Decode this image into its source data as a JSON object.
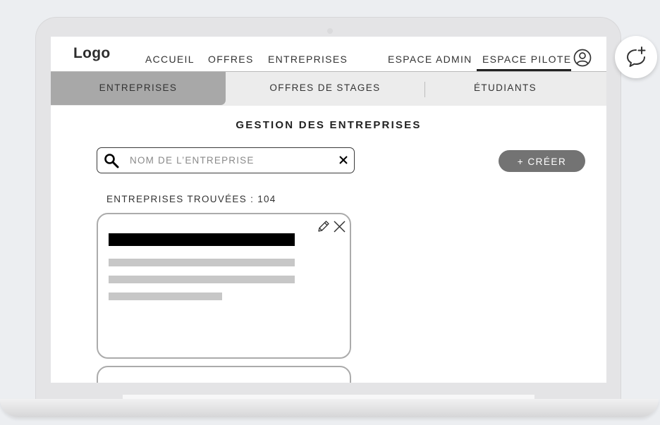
{
  "header": {
    "logo": "Logo",
    "nav": [
      "ACCUEIL",
      "OFFRES",
      "ENTREPRISES",
      "ESPACE ADMIN",
      "ESPACE PILOTE"
    ],
    "active_nav": "ESPACE PILOTE",
    "user_icon": "user-circle-icon"
  },
  "subtabs": [
    "ENTREPRISES",
    "OFFRES DE STAGES",
    "ÉTUDIANTS"
  ],
  "active_subtab": "ENTREPRISES",
  "page": {
    "title": "GESTION DES ENTREPRISES",
    "search": {
      "placeholder": "NOM DE L’ENTREPRISE",
      "value": ""
    },
    "create_button": "+ CRÉER",
    "results_count": "ENTREPRISES TROUVÉES : 104"
  },
  "icons": {
    "search": "search-icon",
    "clear": "close-icon",
    "edit": "pencil-icon",
    "delete": "close-icon",
    "chat": "chat-add-icon"
  },
  "colors": {
    "active_subtab": "#a8a8a8",
    "create_button": "#737373",
    "card_border": "#ababab",
    "placeholder_lines": "#c7c7c7"
  }
}
